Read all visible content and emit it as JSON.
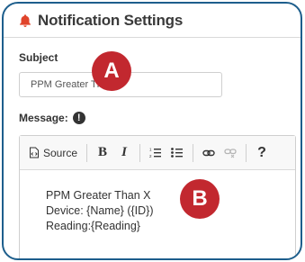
{
  "header": {
    "title": "Notification Settings",
    "icon": "bell-icon",
    "icon_color": "#e0442b"
  },
  "subject": {
    "label": "Subject",
    "value": "PPM Greater Than X"
  },
  "badges": {
    "a": "A",
    "b": "B",
    "color": "#c2282f"
  },
  "message": {
    "label": "Message:",
    "info_icon": "info-icon",
    "info_glyph": "!"
  },
  "toolbar": {
    "source_label": "Source",
    "bold_label": "B",
    "italic_label": "I",
    "numbered_list_icon": "numbered-list-icon",
    "bulleted_list_icon": "bulleted-list-icon",
    "link_icon": "link-icon",
    "unlink_icon": "unlink-icon",
    "help_label": "?"
  },
  "editor": {
    "lines": [
      "PPM Greater Than X",
      "Device: {Name} ({ID})",
      "Reading:{Reading}"
    ]
  },
  "frame_color": "#1d5e8c"
}
